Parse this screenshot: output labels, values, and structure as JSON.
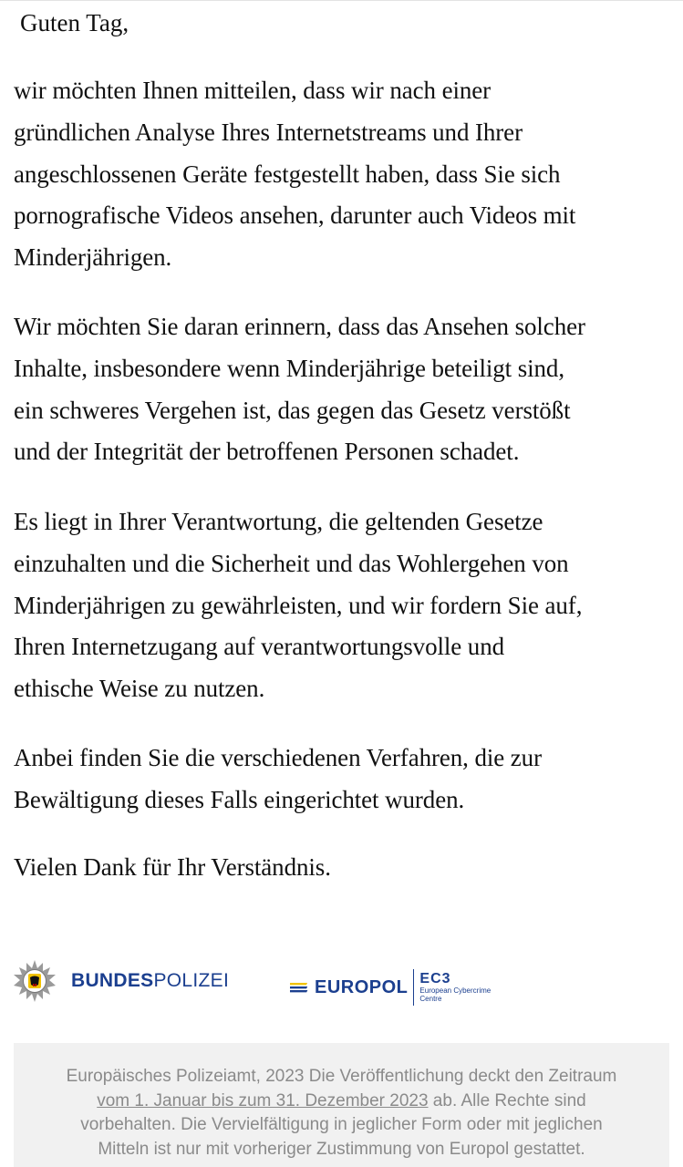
{
  "email": {
    "greeting": "Guten Tag,",
    "paragraphs": [
      {
        "lines": [
          "wir möchten Ihnen mitteilen, dass wir nach einer",
          "gründlichen Analyse Ihres Internetstreams und Ihrer",
          "angeschlossenen Geräte festgestellt haben, dass Sie sich",
          "pornografische Videos ansehen, darunter auch Videos mit",
          "Minderjährigen."
        ]
      },
      {
        "lines": [
          "Wir möchten Sie daran erinnern, dass das Ansehen solcher",
          "Inhalte, insbesondere wenn Minderjährige beteiligt sind,",
          "ein schweres Vergehen ist, das gegen das Gesetz verstößt",
          "und der Integrität der betroffenen Personen schadet."
        ]
      },
      {
        "lines": [
          "Es liegt in Ihrer Verantwortung, die geltenden Gesetze",
          "einzuhalten und die Sicherheit und das Wohlergehen von",
          "Minderjährigen zu gewährleisten, und wir fordern Sie auf,",
          "Ihren Internetzugang auf verantwortungsvolle und",
          "ethische Weise zu nutzen."
        ]
      },
      {
        "lines": [
          "Anbei finden Sie die verschiedenen Verfahren, die zur",
          "Bewältigung dieses Falls eingerichtet wurden."
        ]
      },
      {
        "lines": [
          "Vielen Dank für Ihr Verständnis."
        ]
      }
    ]
  },
  "logos": {
    "bundespolizei": {
      "bold": "BUNDES",
      "light": "POLIZEI",
      "icon": "police-star-icon",
      "color": "#1b3f8f"
    },
    "europol": {
      "word": "EUROPOL",
      "ec3": "EC3",
      "ec3_line1": "European Cybercrime",
      "ec3_line2": "Centre",
      "color": "#1b3f8f"
    }
  },
  "footer": {
    "line1": "Europäisches Polizeiamt, 2023 Die Veröffentlichung deckt den Zeitraum",
    "line2_link": "vom 1. Januar bis zum 31. Dezember 2023",
    "line2_rest": " ab. Alle Rechte sind",
    "line3": "vorbehalten. Die Vervielfältigung in jeglicher Form oder mit jeglichen",
    "line4": "Mitteln ist nur mit vorheriger Zustimmung von Europol gestattet."
  }
}
